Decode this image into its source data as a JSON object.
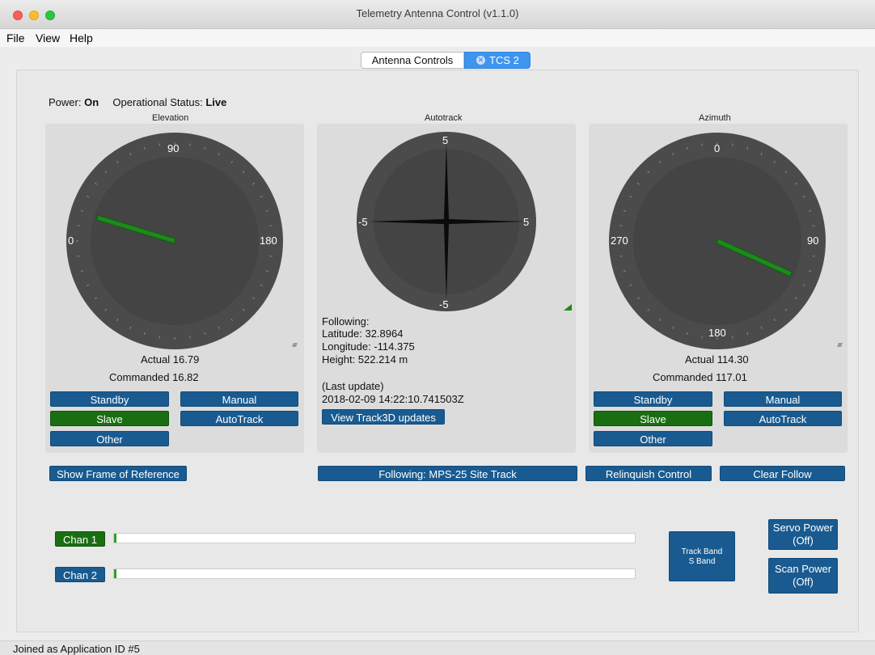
{
  "window": {
    "title": "Telemetry Antenna Control (v1.1.0)"
  },
  "menu": [
    "File",
    "View",
    "Help"
  ],
  "tabs": [
    {
      "label": "Antenna Controls",
      "active": false
    },
    {
      "label": "TCS 2",
      "active": true,
      "close_icon": "close-circle-icon"
    }
  ],
  "status": {
    "power_label": "Power:",
    "power_value": "On",
    "op_label": "Operational Status:",
    "op_value": "Live"
  },
  "elevation": {
    "title": "Elevation",
    "dial_labels": [
      "0",
      "90",
      "180"
    ],
    "actual_label": "Actual",
    "actual_value": "16.79",
    "commanded_label": "Commanded",
    "commanded_value": "16.82",
    "buttons": {
      "standby": "Standby",
      "manual": "Manual",
      "slave": "Slave",
      "autotrack": "AutoTrack",
      "other": "Other"
    },
    "active_mode": "Slave"
  },
  "autotrack": {
    "title": "Autotrack",
    "scale": {
      "top": "5",
      "bottom": "-5",
      "left": "-5",
      "right": "5"
    },
    "following_label": "Following:",
    "latitude": "Latitude: 32.8964",
    "longitude": "Longitude: -114.375",
    "height": "Height: 522.214 m",
    "last_update_label": "(Last update)",
    "last_update_value": "2018-02-09 14:22:10.741503Z",
    "view_button": "View Track3D updates"
  },
  "azimuth": {
    "title": "Azimuth",
    "dial_labels": [
      "0",
      "90",
      "180",
      "270"
    ],
    "actual_label": "Actual",
    "actual_value": "114.30",
    "commanded_label": "Commanded",
    "commanded_value": "117.01",
    "buttons": {
      "standby": "Standby",
      "manual": "Manual",
      "slave": "Slave",
      "autotrack": "AutoTrack",
      "other": "Other"
    },
    "active_mode": "Slave"
  },
  "actions": {
    "show_frame": "Show Frame of Reference",
    "following": "Following: MPS-25 Site Track",
    "relinquish": "Relinquish Control",
    "clear_follow": "Clear Follow"
  },
  "channels": [
    {
      "label": "Chan 1",
      "level": 0.0,
      "active": true
    },
    {
      "label": "Chan 2",
      "level": 0.0,
      "active": false
    }
  ],
  "track_band": {
    "line1": "Track Band",
    "line2": "S Band"
  },
  "servo_power": {
    "line1": "Servo Power",
    "line2": "(Off)"
  },
  "scan_power": {
    "line1": "Scan Power",
    "line2": "(Off)"
  },
  "statusbar": {
    "text": "Joined as Application ID #5"
  },
  "colors": {
    "active_green": "#1a6e12",
    "button_blue": "#195b90",
    "needle_green": "#1c8a1c",
    "tab_active": "#3d95f0"
  }
}
